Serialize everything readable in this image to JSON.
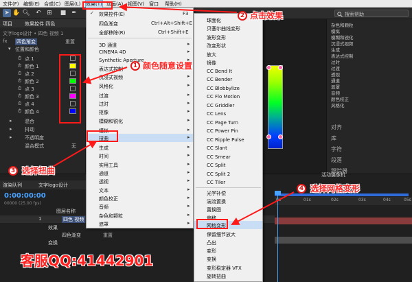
{
  "menubar": {
    "items": [
      "文件(F)",
      "编辑(E)",
      "合成(C)",
      "图层(L)",
      "效果(T)",
      "动画(A)",
      "视图(V)",
      "窗口",
      "帮助(H)"
    ],
    "open_index": 4
  },
  "toolbar": {
    "search_placeholder": "搜索帮助"
  },
  "effect_panel": {
    "tab1": "项目",
    "tab2": "效果控件 四色",
    "layer_path": "文字logo设计 • 四色 视频 1",
    "effect_name": "四色渐变",
    "reset_label": "重置",
    "group_label": "位置和颜色",
    "rows": [
      {
        "label": "点 1"
      },
      {
        "label": "颜色 1"
      },
      {
        "label": "点 2"
      },
      {
        "label": "颜色 2"
      },
      {
        "label": "点 3"
      },
      {
        "label": "颜色 3"
      },
      {
        "label": "点 4"
      },
      {
        "label": "颜色 4"
      }
    ],
    "swatch_colors": [
      "#ffff00",
      "#00ff00",
      "#ff00ff",
      "#0000ff"
    ],
    "extra_rows": [
      {
        "label": "混合",
        "value": ""
      },
      {
        "label": "抖动",
        "value": ""
      },
      {
        "label": "不透明度",
        "value": ""
      },
      {
        "label": "混合模式",
        "value": "无"
      }
    ]
  },
  "effect_menu": {
    "items": [
      {
        "label": "效果控件(E)",
        "shortcut": "F3",
        "checked": true
      },
      {
        "label": "四色渐变",
        "shortcut": "Ctrl+Alt+Shift+E"
      },
      {
        "label": "全部移除(R)",
        "shortcut": "Ctrl+Shift+E"
      },
      {
        "label": "3D 通道",
        "arrow": true
      },
      {
        "label": "CINEMA 4D",
        "arrow": true
      },
      {
        "label": "Synthetic Aperture",
        "arrow": true
      },
      {
        "label": "表达式控制",
        "arrow": true
      },
      {
        "label": "沉浸式视频",
        "arrow": true
      },
      {
        "label": "风格化",
        "arrow": true
      },
      {
        "label": "过渡",
        "arrow": true
      },
      {
        "label": "过时",
        "arrow": true
      },
      {
        "label": "抠像",
        "arrow": true
      },
      {
        "label": "模糊和锐化",
        "arrow": true
      },
      {
        "label": "模拟",
        "arrow": true
      },
      {
        "label": "扭曲",
        "arrow": true
      },
      {
        "label": "生成",
        "arrow": true
      },
      {
        "label": "时间",
        "arrow": true
      },
      {
        "label": "实用工具",
        "arrow": true
      },
      {
        "label": "通道",
        "arrow": true
      },
      {
        "label": "透视",
        "arrow": true
      },
      {
        "label": "文本",
        "arrow": true
      },
      {
        "label": "颜色校正",
        "arrow": true
      },
      {
        "label": "音频",
        "arrow": true
      },
      {
        "label": "杂色和颗粒",
        "arrow": true
      },
      {
        "label": "遮罩",
        "arrow": true
      }
    ],
    "highlight_index": 14
  },
  "submenu": {
    "items": [
      "球面化",
      "贝塞尔曲线变形",
      "波形变形",
      "改变形状",
      "放大",
      "镜像",
      "CC Bend It",
      "CC Bender",
      "CC Blobbylize",
      "CC Flo Motion",
      "CC Griddler",
      "CC Lens",
      "CC Page Turn",
      "CC Power Pin",
      "CC Ripple Pulse",
      "CC Slant",
      "CC Smear",
      "CC Split",
      "CC Split 2",
      "CC Tiler",
      "光学补偿",
      "湍流置换",
      "置换图",
      "偏移",
      "网格变形",
      "保留细节放大",
      "凸出",
      "变形",
      "变换",
      "变形稳定器 VFX",
      "旋转扭曲"
    ],
    "highlight_index": 24
  },
  "right_panel": {
    "tree": [
      "杂色和颗粒",
      "模拟",
      "模糊和锐化",
      "沉浸式视频",
      "生成",
      "表达式控制",
      "过时",
      "过渡",
      "透视",
      "通道",
      "遮罩",
      "音频",
      "颜色校正",
      "风格化"
    ],
    "sections": [
      "对齐",
      "库",
      "字符",
      "段落",
      "跟踪器"
    ]
  },
  "timeline": {
    "tab1": "渲染队列",
    "tab2": "文字logo设计",
    "timecode": "0:00:00:00",
    "frame_info": "00000 (25.00 fps)",
    "col_name": "图层名称",
    "layer_number": "1",
    "layer_name": "四色 视频",
    "effects_label": "效果",
    "fx_label": "四色渐变",
    "reset_label": "重置",
    "transform_label": "变换",
    "ticks": [
      "0s",
      "01s",
      "02s",
      "03s",
      "04s",
      "05s"
    ],
    "status_text": "活动摄像机"
  },
  "annotations": [
    {
      "num": "1",
      "text": "颜色随意设置"
    },
    {
      "num": "2",
      "text": "点击效果"
    },
    {
      "num": "3",
      "text": "选择扭曲"
    },
    {
      "num": "4",
      "text": "选择网格变形"
    }
  ],
  "watermark": "客服QQ:41442901"
}
